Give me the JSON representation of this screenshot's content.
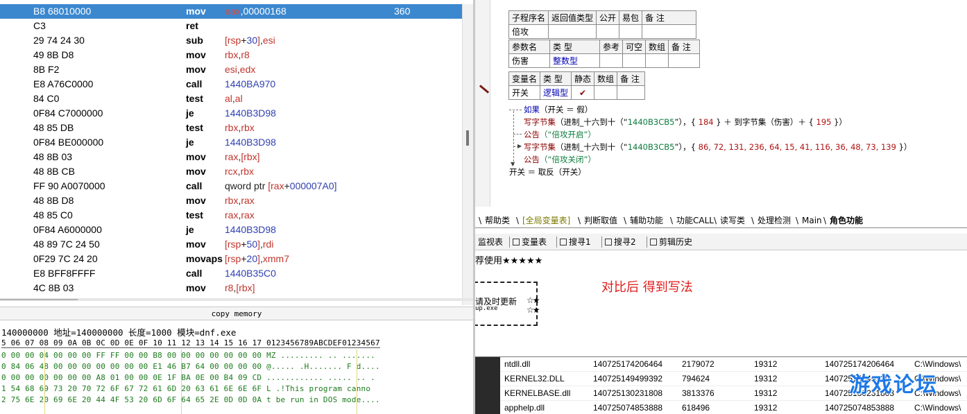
{
  "disassembly": {
    "rows": [
      {
        "bytes": "B8 68010000",
        "mnemonic": "mov",
        "ops": [
          {
            "t": "eax",
            "c": "reg"
          },
          {
            "t": ",",
            "c": "plain"
          },
          {
            "t": "00000168",
            "c": "num"
          }
        ],
        "comment": "360",
        "selected": true
      },
      {
        "bytes": "C3",
        "mnemonic": "ret",
        "ops": [],
        "comment": ""
      },
      {
        "bytes": "29 74 24 30",
        "mnemonic": "sub",
        "ops": [
          {
            "t": "[",
            "c": "reg"
          },
          {
            "t": "rsp",
            "c": "reg"
          },
          {
            "t": "+",
            "c": "dark"
          },
          {
            "t": "30",
            "c": "num"
          },
          {
            "t": "]",
            "c": "reg"
          },
          {
            "t": ",",
            "c": "dark"
          },
          {
            "t": "esi",
            "c": "reg"
          }
        ],
        "comment": ""
      },
      {
        "bytes": "49 8B D8",
        "mnemonic": "mov",
        "ops": [
          {
            "t": "rbx",
            "c": "reg"
          },
          {
            "t": ",",
            "c": "dark"
          },
          {
            "t": "r8",
            "c": "reg"
          }
        ],
        "comment": ""
      },
      {
        "bytes": "8B F2",
        "mnemonic": "mov",
        "ops": [
          {
            "t": "esi",
            "c": "reg"
          },
          {
            "t": ",",
            "c": "dark"
          },
          {
            "t": "edx",
            "c": "reg"
          }
        ],
        "comment": ""
      },
      {
        "bytes": "E8 A76C0000",
        "mnemonic": "call",
        "ops": [
          {
            "t": "1440BA970",
            "c": "num"
          }
        ],
        "comment": ""
      },
      {
        "bytes": "84 C0",
        "mnemonic": "test",
        "ops": [
          {
            "t": "al",
            "c": "reg"
          },
          {
            "t": ",",
            "c": "dark"
          },
          {
            "t": "al",
            "c": "reg"
          }
        ],
        "comment": ""
      },
      {
        "bytes": "0F84 C7000000",
        "mnemonic": "je",
        "ops": [
          {
            "t": "1440B3D98",
            "c": "num"
          }
        ],
        "comment": ""
      },
      {
        "bytes": "48 85 DB",
        "mnemonic": "test",
        "ops": [
          {
            "t": "rbx",
            "c": "reg"
          },
          {
            "t": ",",
            "c": "dark"
          },
          {
            "t": "rbx",
            "c": "reg"
          }
        ],
        "comment": ""
      },
      {
        "bytes": "0F84 BE000000",
        "mnemonic": "je",
        "ops": [
          {
            "t": "1440B3D98",
            "c": "num"
          }
        ],
        "comment": ""
      },
      {
        "bytes": "48 8B 03",
        "mnemonic": "mov",
        "ops": [
          {
            "t": "rax",
            "c": "reg"
          },
          {
            "t": ",",
            "c": "dark"
          },
          {
            "t": "[rbx]",
            "c": "reg"
          }
        ],
        "comment": ""
      },
      {
        "bytes": "48 8B CB",
        "mnemonic": "mov",
        "ops": [
          {
            "t": "rcx",
            "c": "reg"
          },
          {
            "t": ",",
            "c": "dark"
          },
          {
            "t": "rbx",
            "c": "reg"
          }
        ],
        "comment": ""
      },
      {
        "bytes": "FF 90 A0070000",
        "mnemonic": "call",
        "ops": [
          {
            "t": "qword ptr ",
            "c": "dark"
          },
          {
            "t": "[rax",
            "c": "reg"
          },
          {
            "t": "+",
            "c": "dark"
          },
          {
            "t": "000007A0]",
            "c": "num"
          }
        ],
        "comment": ""
      },
      {
        "bytes": "48 8B D8",
        "mnemonic": "mov",
        "ops": [
          {
            "t": "rbx",
            "c": "reg"
          },
          {
            "t": ",",
            "c": "dark"
          },
          {
            "t": "rax",
            "c": "reg"
          }
        ],
        "comment": ""
      },
      {
        "bytes": "48 85 C0",
        "mnemonic": "test",
        "ops": [
          {
            "t": "rax",
            "c": "reg"
          },
          {
            "t": ",",
            "c": "dark"
          },
          {
            "t": "rax",
            "c": "reg"
          }
        ],
        "comment": ""
      },
      {
        "bytes": "0F84 A6000000",
        "mnemonic": "je",
        "ops": [
          {
            "t": "1440B3D98",
            "c": "num"
          }
        ],
        "comment": ""
      },
      {
        "bytes": "48 89 7C 24 50",
        "mnemonic": "mov",
        "ops": [
          {
            "t": "[",
            "c": "reg"
          },
          {
            "t": "rsp",
            "c": "reg"
          },
          {
            "t": "+",
            "c": "dark"
          },
          {
            "t": "50",
            "c": "num"
          },
          {
            "t": "]",
            "c": "reg"
          },
          {
            "t": ",",
            "c": "dark"
          },
          {
            "t": "rdi",
            "c": "reg"
          }
        ],
        "comment": ""
      },
      {
        "bytes": "0F29 7C 24 20",
        "mnemonic": "movaps",
        "ops": [
          {
            "t": "[",
            "c": "reg"
          },
          {
            "t": "rsp",
            "c": "reg"
          },
          {
            "t": "+",
            "c": "dark"
          },
          {
            "t": "20",
            "c": "num"
          },
          {
            "t": "]",
            "c": "reg"
          },
          {
            "t": ",",
            "c": "dark"
          },
          {
            "t": "xmm7",
            "c": "reg"
          }
        ],
        "comment": ""
      },
      {
        "bytes": "E8 BFF8FFFF",
        "mnemonic": "call",
        "ops": [
          {
            "t": "1440B35C0",
            "c": "num"
          }
        ],
        "comment": ""
      },
      {
        "bytes": "4C 8B 03",
        "mnemonic": "mov",
        "ops": [
          {
            "t": "r8",
            "c": "reg"
          },
          {
            "t": ",",
            "c": "dark"
          },
          {
            "t": "[rbx]",
            "c": "reg"
          }
        ],
        "comment": ""
      }
    ]
  },
  "memory": {
    "title": "copy memory",
    "info": "140000000 地址=140000000 长度=1000 模块=dnf.exe",
    "header": "5 06 07 08 09 0A 0B 0C 0D 0E 0F 10 11 12 13 14 15 16 17 0123456789ABCDEF01234567",
    "rows": [
      "0 00 00 04 00 00 00 FF FF 00 00 B8 00 00 00 00 00 00 00 MZ ......... .. .......",
      "0 84 06 48 00 00 00 00 00 00 00 E1 46 B7 64 00 00 00 00 @..... .H....... F d....",
      "0 00 00 00 00 00 00 A8 01 00 00 0E 1F BA 0E 00 B4 09 CD ............ ..... .. .",
      "1 54 68 69 73 20 70 72 6F 67 72 61 6D 20 63 61 6E 6E 6F L .!This program canno",
      "2 75 6E 20 69 6E 20 44 4F 53 20 6D 6F 64 65 2E 0D 0D 0A t be run in DOS mode...."
    ]
  },
  "editor": {
    "sub_table": {
      "headers": [
        "子程序名",
        "返回值类型",
        "公开",
        "易包",
        "备 注"
      ],
      "name": "倍攻",
      "param_headers": [
        "参数名",
        "类 型",
        "参考",
        "可空",
        "数组",
        "备 注"
      ],
      "param": {
        "name": "伤害",
        "type": "整数型"
      }
    },
    "var_table": {
      "headers": [
        "变量名",
        "类 型",
        "静态",
        "数组",
        "备 注"
      ],
      "name": "开关",
      "type": "逻辑型",
      "static_mark": "✔"
    },
    "code": {
      "line1_kw": "如果",
      "line1_rest": "（开关 ＝ 假）",
      "line2_fn": "写字节集",
      "line2_a": "（进制_十六到十（“",
      "line2_str": "1440B3CB5",
      "line2_b": "”），{ ",
      "line2_n1": "184",
      "line2_c": " } ＋ 到字节集（伤害）＋ { ",
      "line2_n2": "195",
      "line2_d": " }）",
      "line3_fn": "公告",
      "line3_rest": "（“倍攻开启”）",
      "line4_fn": "写字节集",
      "line4_a": "（进制_十六到十（“",
      "line4_str": "1440B3CB5",
      "line4_b": "”），{ ",
      "line4_nums": "86, 72, 131, 236, 64, 15, 41, 116, 36, 48, 73, 139",
      "line4_c": " }）",
      "line5_fn": "公告",
      "line5_rest": "（“倍攻关闭”）",
      "line6": "开关 ＝ 取反（开关）"
    }
  },
  "tabs_main": [
    "帮助类",
    "[全局变量表]",
    "判断取值",
    "辅助功能",
    "功能CALL",
    "读写类",
    "处理检测",
    "Main",
    "角色功能"
  ],
  "tabs_tool": [
    "监视表",
    "变量表",
    "搜寻1",
    "搜寻2",
    "剪辑历史"
  ],
  "notes": {
    "recommend": "荐使用★★★★★",
    "update": "请及时更新",
    "update_sub": "up.exe",
    "stars_a": "☆★",
    "stars_b": "☆★",
    "annotation": "对比后 得到写法"
  },
  "modules": [
    [
      "ntdll.dll",
      "140725174206464",
      "2179072",
      "19312",
      "140725174206464",
      "C:\\Windows\\"
    ],
    [
      "KERNEL32.DLL",
      "140725149499392",
      "794624",
      "19312",
      "14072514949939",
      "C:\\Windows\\"
    ],
    [
      "KERNELBASE.dll",
      "140725130231808",
      "3813376",
      "19312",
      "140725130231808",
      "C:\\Windows\\"
    ],
    [
      "apphelp.dll",
      "140725074853888",
      "618496",
      "19312",
      "140725074853888",
      "C:\\Windows\\"
    ]
  ],
  "watermark": "游戏论坛",
  "colors": {
    "selection": "#3b88cf",
    "register": "#c0342c",
    "number": "#2f3fb0",
    "annotation": "#e01a1a",
    "watermark": "#1d78e6"
  }
}
